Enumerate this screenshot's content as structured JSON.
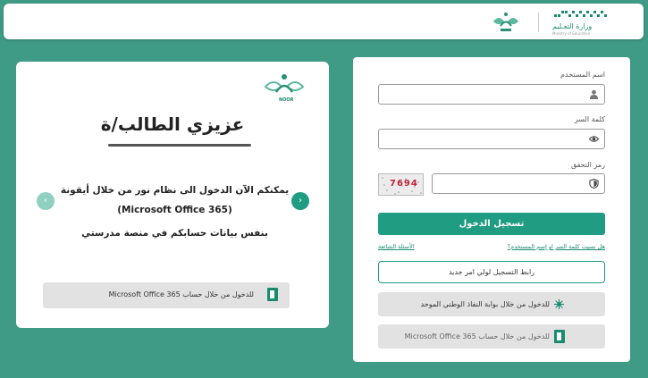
{
  "header": {
    "moe_title": "وزارة التعـليم",
    "moe_subtitle": "Ministry of Education",
    "brand_color": "#1a8b6f"
  },
  "left_panel": {
    "logo_text": "NOOR",
    "greeting": "عزيزي الطالب/ة",
    "message_line1": "يمكنكم الآن الدخول الى نظام نور من خلال أيقونة",
    "message_line2": "(Microsoft Office 365)",
    "message_line3": "بنفس بيانات حسابكم في منصة مدرستي",
    "office_button_label": "للدخول من خلال حساب Microsoft Office 365",
    "next_icon": "chevron-right-icon",
    "prev_icon": "chevron-left-icon"
  },
  "login_form": {
    "username_label": "اسم المستخدم",
    "username_value": "",
    "password_label": "كلمة السر",
    "password_value": "",
    "captcha_label": "رمز التحقق",
    "captcha_value": "",
    "captcha_text": "7694",
    "login_button": "تسجيل الدخول",
    "forgot_link": "هل نسيت كلمة السر او إسم المستخدم؟",
    "faq_link": "الأسئلة الشائعة",
    "register_link": "رابط التسجيل لولي امر جديد",
    "nafath_button": "للدخول من خلال بوابة النفاذ الوطني الموحد",
    "office_button": "للدخول من خلال حساب Microsoft Office 365",
    "accent_color": "#1f9c82"
  }
}
